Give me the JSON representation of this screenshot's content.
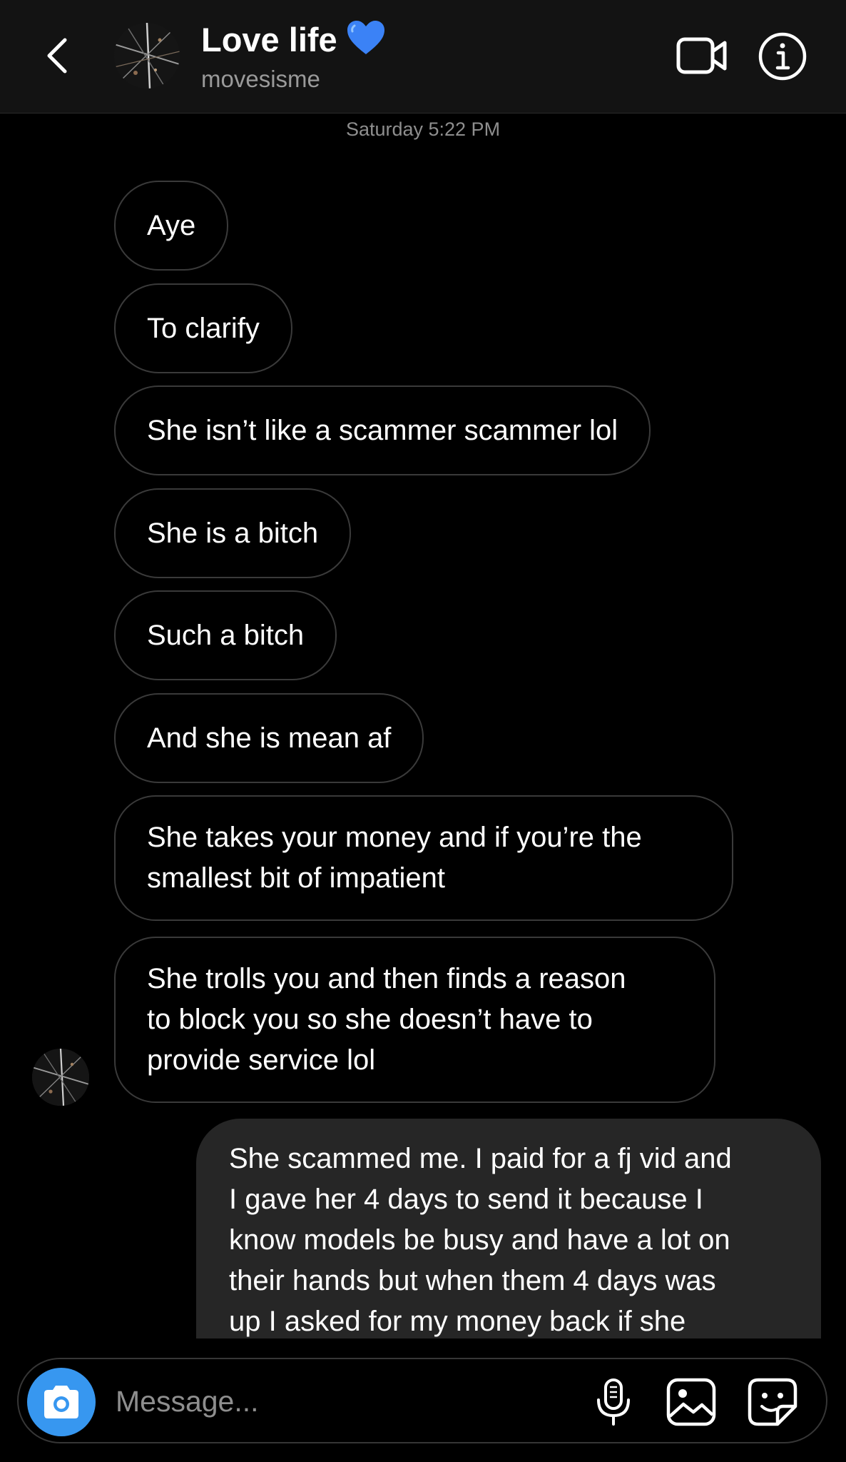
{
  "header": {
    "title": "Love life",
    "username": "movesisme"
  },
  "timestamp": "Saturday 5:22 PM",
  "messages": [
    {
      "text": "Aye"
    },
    {
      "text": "To clarify"
    },
    {
      "text": "She isn’t like a scammer scammer lol"
    },
    {
      "text": "She is a bitch"
    },
    {
      "text": "Such a bitch"
    },
    {
      "text": "And she is mean af"
    },
    {
      "lines": [
        "She takes your money and if you’re the",
        "smallest bit of impatient"
      ]
    },
    {
      "lines": [
        "She trolls you and then finds a reason",
        "to block you so she doesn’t have to",
        "provide service lol"
      ]
    }
  ],
  "my_message": {
    "lines": [
      "She scammed me. I paid for a fj vid and",
      "I gave her 4 days to send it because I",
      "know models be busy and have a lot on",
      "their hands but when them 4 days was",
      "up I asked for my money back if she"
    ]
  },
  "composer": {
    "placeholder": "Message..."
  },
  "colors": {
    "accent": "#3797f0",
    "outgoing_bubble": "#262626",
    "incoming_border": "#3a3a3a",
    "heart": "#3b82f6"
  },
  "icons": [
    "back-icon",
    "video-call-icon",
    "info-icon",
    "camera-icon",
    "microphone-icon",
    "gallery-icon",
    "sticker-icon"
  ]
}
